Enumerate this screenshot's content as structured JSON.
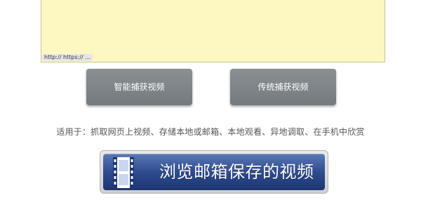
{
  "url_box": {
    "hint": "http:// https:// ..."
  },
  "buttons": {
    "smart_capture": "智能捕获视频",
    "classic_capture": "传统捕获视频"
  },
  "applies_to": "适用于：抓取网页上视频、存储本地或邮箱、本地观看、异地调取、在手机中欣赏",
  "big_button": {
    "label": "浏览邮箱保存的视频",
    "icon": "film-strip-icon"
  },
  "colors": {
    "textarea_bg": "#fdf7c1",
    "gray_button": "#7e8487",
    "big_button_blue": "#2f4c8f"
  }
}
